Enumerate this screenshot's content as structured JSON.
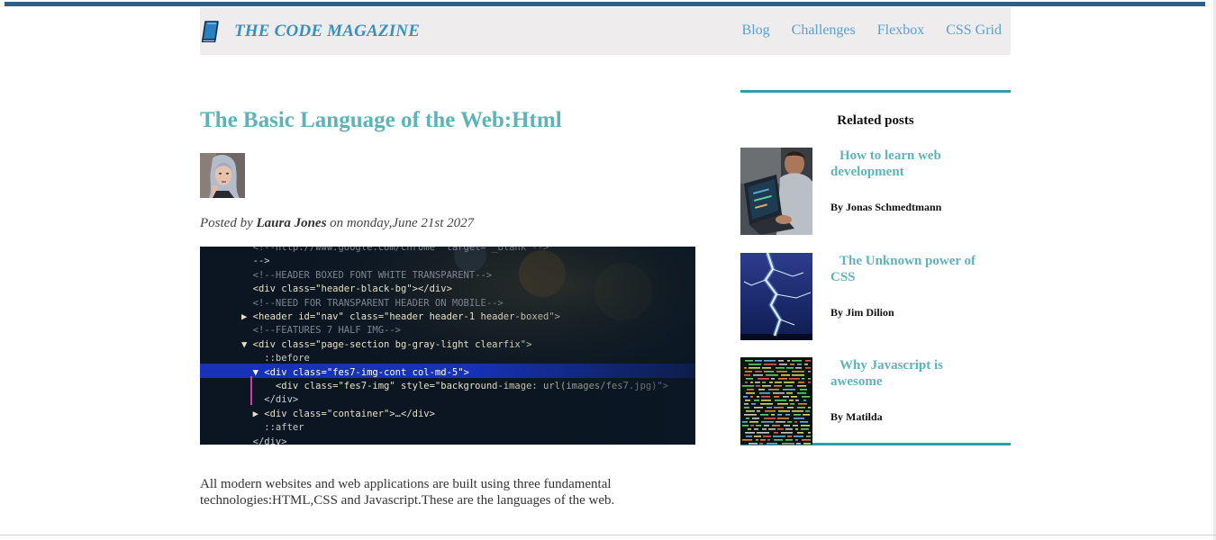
{
  "header": {
    "logo_text": "THE CODE MAGAZINE",
    "logo_icon": "book-icon",
    "nav": [
      {
        "label": "Blog"
      },
      {
        "label": "Challenges"
      },
      {
        "label": "Flexbox"
      },
      {
        "label": "CSS Grid"
      }
    ]
  },
  "article": {
    "title": "The Basic Language of the Web:Html",
    "posted_prefix": "Posted by",
    "author": "Laura Jones",
    "posted_suffix": "on monday,June 21st 2027",
    "body": "All modern websites and web applications are built using three fundamental technologies:HTML,CSS and Javascript.These are the languages of the web.",
    "code_lines": [
      "  <!--http://www.google.com/chrome\" target=\"_blank\"-->",
      "  -->",
      "  <!--HEADER BOXED FONT WHITE TRANSPARENT-->",
      "  <div class=\"header-black-bg\"></div>",
      "  <!--NEED FOR TRANSPARENT HEADER ON MOBILE-->",
      "▶ <header id=\"nav\" class=\"header header-1 header-boxed\">",
      "  <!--FEATURES 7 HALF IMG-->",
      "▼ <div class=\"page-section bg-gray-light clearfix\">",
      "    ::before",
      "  ▼ <div class=\"fes7-img-cont col-md-5\">",
      "      <div class=\"fes7-img\" style=\"background-image: url(images/fes7.jpg)\">",
      "    </div>",
      "  ▶ <div class=\"container\">…</div>",
      "    ::after",
      "  </div>"
    ]
  },
  "sidebar": {
    "title": "Related posts",
    "items": [
      {
        "title": "How to learn web development",
        "author": "By Jonas Schmedtmann"
      },
      {
        "title": "The Unknown power of CSS",
        "author": "By Jim Dilion"
      },
      {
        "title": "Why Javascript is awesome",
        "author": "By Matilda"
      }
    ]
  },
  "colors": {
    "accent": "#5eb3b8",
    "nav_link": "#5b9fd4",
    "logo": "#3a8ec0",
    "top_bar": "#2e5f86",
    "sidebar_border": "#2e9da8"
  }
}
